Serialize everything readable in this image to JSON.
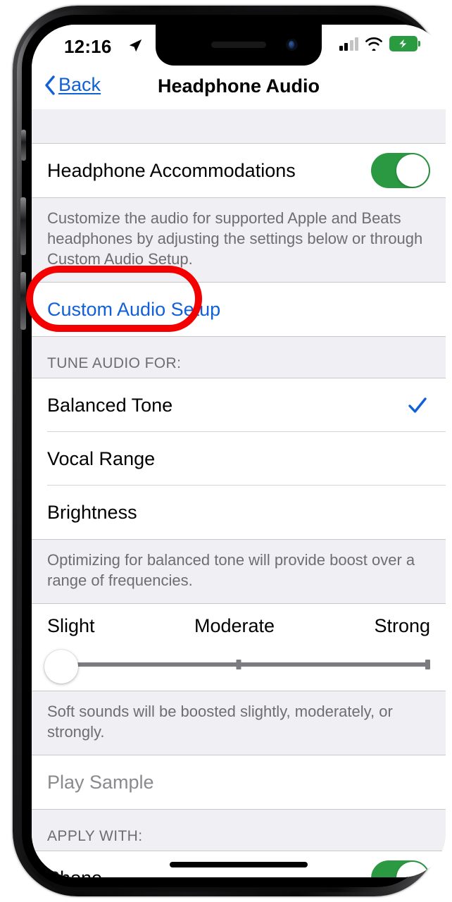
{
  "status_bar": {
    "time": "12:16",
    "location_icon": "location-arrow-icon",
    "signal_icon": "cellular-signal-icon",
    "signal_bars_filled": 2,
    "signal_bars_total": 4,
    "wifi_icon": "wifi-icon",
    "battery_icon": "battery-charging-icon"
  },
  "nav": {
    "back_label": "Back",
    "back_icon": "chevron-left-icon",
    "title": "Headphone Audio"
  },
  "sections": {
    "accommodations": {
      "row_label": "Headphone Accommodations",
      "toggle_state": "on",
      "footer": "Customize the audio for supported Apple and Beats headphones by adjusting the settings below or through Custom Audio Setup."
    },
    "custom_setup": {
      "row_label": "Custom Audio Setup"
    },
    "tune_audio": {
      "header": "TUNE AUDIO FOR:",
      "options": [
        {
          "label": "Balanced Tone",
          "selected": true
        },
        {
          "label": "Vocal Range",
          "selected": false
        },
        {
          "label": "Brightness",
          "selected": false
        }
      ],
      "check_icon": "checkmark-icon",
      "footer": "Optimizing for balanced tone will provide boost over a range of frequencies."
    },
    "strength_slider": {
      "label_left": "Slight",
      "label_mid": "Moderate",
      "label_right": "Strong",
      "value_position": "Slight",
      "footer": "Soft sounds will be boosted slightly, moderately, or strongly."
    },
    "play_sample": {
      "row_label": "Play Sample",
      "state": "disabled"
    },
    "apply_with": {
      "header": "APPLY WITH:",
      "rows": [
        {
          "label": "Phone",
          "toggle_state": "on"
        }
      ]
    }
  },
  "annotation": {
    "shape": "rounded-rectangle-highlight",
    "color": "#f40000",
    "targets": "Custom Audio Setup"
  },
  "colors": {
    "accent_blue": "#1060d8",
    "toggle_green": "#2a9942",
    "group_bg": "#efeff4",
    "annotation_red": "#f40000"
  }
}
